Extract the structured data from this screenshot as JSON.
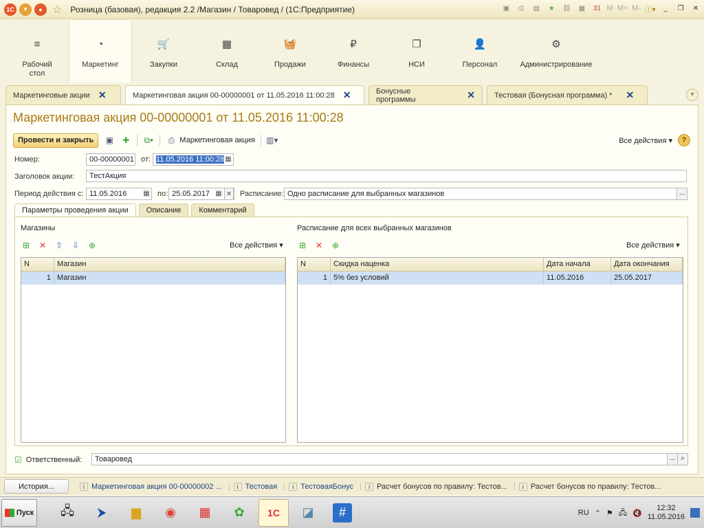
{
  "window": {
    "title": "Розница (базовая), редакция 2.2 /Магазин / Товаровед /  (1С:Предприятие)",
    "logo": "1С",
    "right_m": [
      "M",
      "M+",
      "M-"
    ]
  },
  "sections": [
    {
      "label": "Рабочий стол",
      "icon": "≡"
    },
    {
      "label": "Маркетинг",
      "icon": "◔"
    },
    {
      "label": "Закупки",
      "icon": "🛒"
    },
    {
      "label": "Склад",
      "icon": "▦"
    },
    {
      "label": "Продажи",
      "icon": "🧺"
    },
    {
      "label": "Финансы",
      "icon": "₽"
    },
    {
      "label": "НСИ",
      "icon": "❐"
    },
    {
      "label": "Персонал",
      "icon": "👤"
    },
    {
      "label": "Администрирование",
      "icon": "⚙"
    }
  ],
  "tabs": [
    {
      "label": "Маркетинговые акции"
    },
    {
      "label": "Маркетинговая акция 00-00000001 от 11.05.2016 11:00:28"
    },
    {
      "label": "Бонусные программы"
    },
    {
      "label": "Тестовая (Бонусная программа) *"
    }
  ],
  "form": {
    "title": "Маркетинговая акция 00-00000001 от 11.05.2016 11:00:28",
    "post_close": "Провести и закрыть",
    "print_label": "Маркетинговая акция",
    "all_actions": "Все действия",
    "help": "?",
    "number_label": "Номер:",
    "number_value": "00-00000001",
    "from_label": "от:",
    "from_value": "11.05.2016 11:00:28",
    "header_label": "Заголовок акции:",
    "header_value": "ТестАкция",
    "period_label": "Период действия с:",
    "period_from": "11.05.2016",
    "period_to_label": "по:",
    "period_to": "25.05.2017",
    "schedule_label": "Расписание:",
    "schedule_value": "Одно расписание для выбранных магазинов",
    "inner_tabs": [
      "Параметры проведения акции",
      "Описание",
      "Комментарий"
    ],
    "stores": {
      "title": "Магазины",
      "all_actions": "Все действия",
      "columns": [
        "N",
        "Магазин"
      ],
      "rows": [
        [
          "1",
          "Магазин"
        ]
      ]
    },
    "schedule": {
      "title": "Расписание для всех выбранных магазинов",
      "all_actions": "Все действия",
      "columns": [
        "N",
        "Скидка наценка",
        "Дата начала",
        "Дата окончания"
      ],
      "rows": [
        [
          "1",
          "5% без условий",
          "11.05.2016",
          "25.05.2017"
        ]
      ]
    },
    "responsible_label": "Ответственный:",
    "responsible_value": "Товаровед"
  },
  "history": {
    "button": "История...",
    "items": [
      "Маркетинговая акция 00-00000002 ...",
      "Тестовая",
      "ТестоваяБонус",
      "Расчет бонусов по правилу: Тестов...",
      "Расчет бонусов по правилу: Тестов..."
    ]
  },
  "taskbar": {
    "start": "Пуск",
    "lang": "RU",
    "time": "12:32",
    "date": "11.05.2016"
  }
}
